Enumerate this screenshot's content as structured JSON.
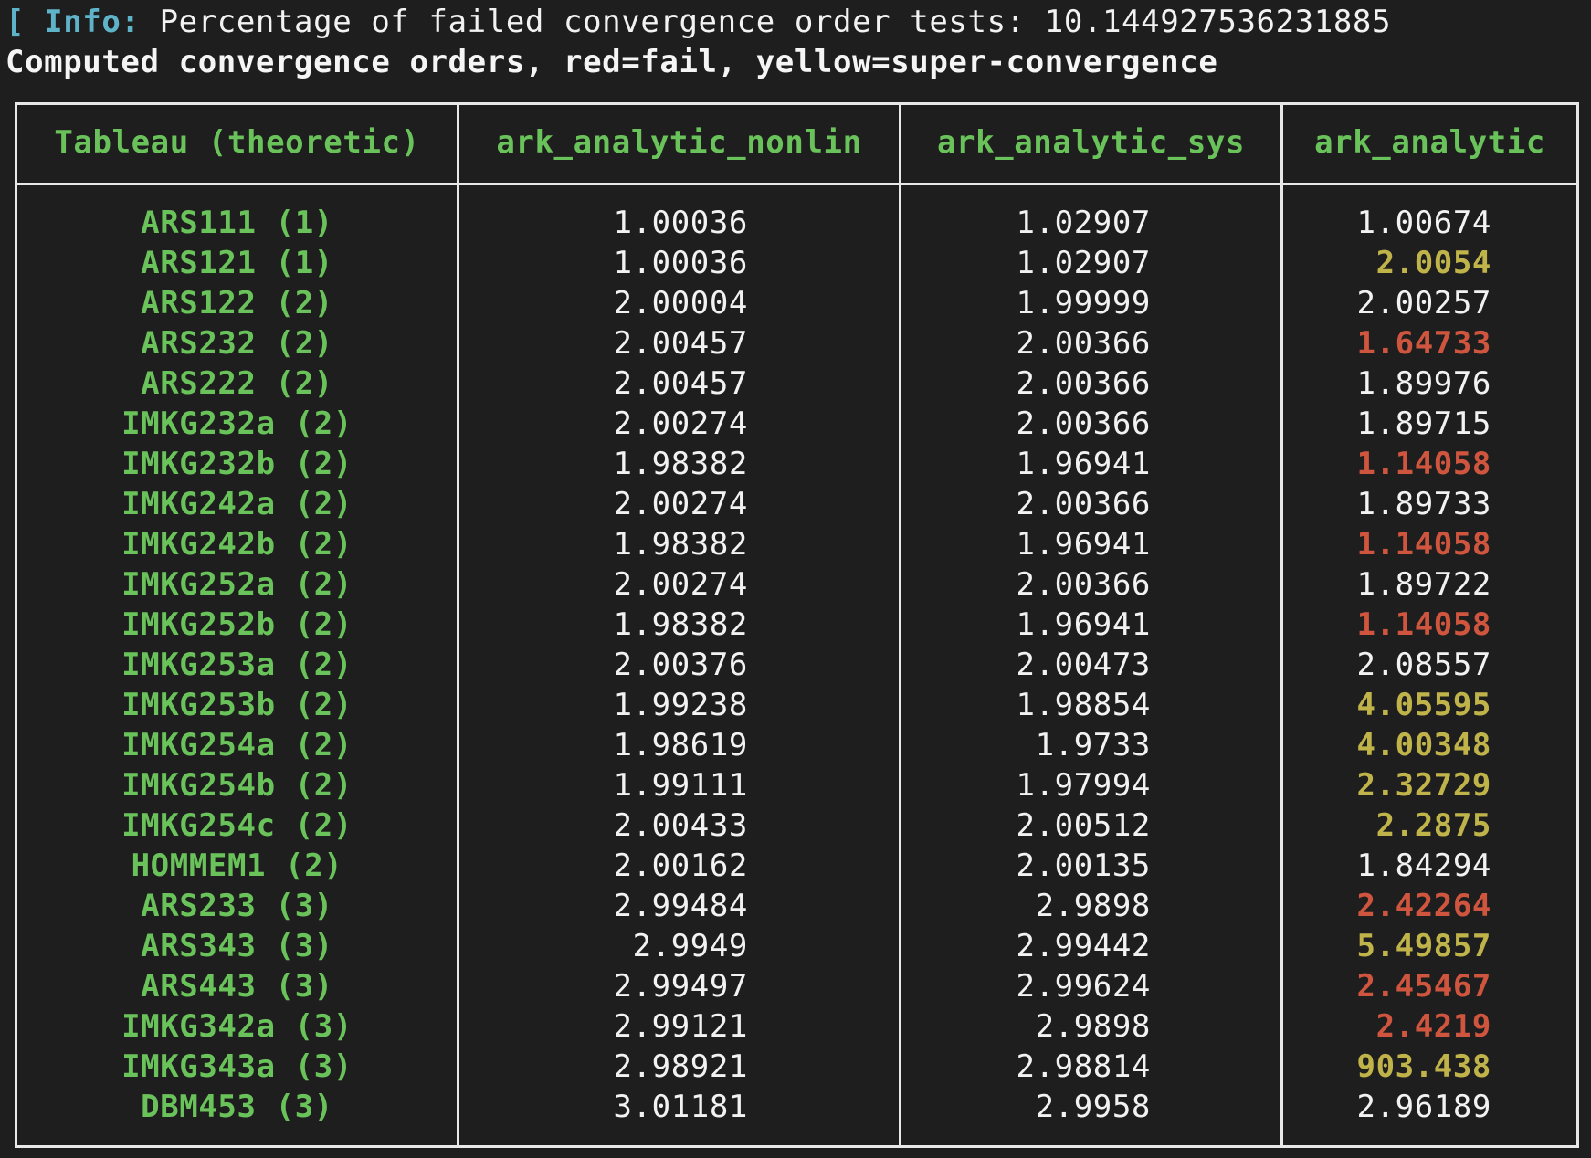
{
  "info": {
    "tag": "[ Info:",
    "text": " Percentage of failed convergence order tests: 10.144927536231885"
  },
  "heading": "Computed convergence orders, red=fail, yellow=super-convergence",
  "colors": {
    "background": "#1e1e1e",
    "text": "#f2f2f2",
    "info": "#5fb3c8",
    "header_green": "#6ac35a",
    "fail_red": "#d0553e",
    "super_yellow": "#bfb34a",
    "border": "#e8e8e8"
  },
  "table": {
    "headers": [
      "Tableau (theoretic)",
      "ark_analytic_nonlin",
      "ark_analytic_sys",
      "ark_analytic"
    ],
    "rows": [
      {
        "name": "ARS111 (1)",
        "v": [
          "1.00036",
          "1.02907",
          "1.00674"
        ],
        "s": [
          "n",
          "n",
          "n"
        ]
      },
      {
        "name": "ARS121 (1)",
        "v": [
          "1.00036",
          "1.02907",
          "2.0054"
        ],
        "s": [
          "n",
          "n",
          "super"
        ]
      },
      {
        "name": "ARS122 (2)",
        "v": [
          "2.00004",
          "1.99999",
          "2.00257"
        ],
        "s": [
          "n",
          "n",
          "n"
        ]
      },
      {
        "name": "ARS232 (2)",
        "v": [
          "2.00457",
          "2.00366",
          "1.64733"
        ],
        "s": [
          "n",
          "n",
          "fail"
        ]
      },
      {
        "name": "ARS222 (2)",
        "v": [
          "2.00457",
          "2.00366",
          "1.89976"
        ],
        "s": [
          "n",
          "n",
          "n"
        ]
      },
      {
        "name": "IMKG232a (2)",
        "v": [
          "2.00274",
          "2.00366",
          "1.89715"
        ],
        "s": [
          "n",
          "n",
          "n"
        ]
      },
      {
        "name": "IMKG232b (2)",
        "v": [
          "1.98382",
          "1.96941",
          "1.14058"
        ],
        "s": [
          "n",
          "n",
          "fail"
        ]
      },
      {
        "name": "IMKG242a (2)",
        "v": [
          "2.00274",
          "2.00366",
          "1.89733"
        ],
        "s": [
          "n",
          "n",
          "n"
        ]
      },
      {
        "name": "IMKG242b (2)",
        "v": [
          "1.98382",
          "1.96941",
          "1.14058"
        ],
        "s": [
          "n",
          "n",
          "fail"
        ]
      },
      {
        "name": "IMKG252a (2)",
        "v": [
          "2.00274",
          "2.00366",
          "1.89722"
        ],
        "s": [
          "n",
          "n",
          "n"
        ]
      },
      {
        "name": "IMKG252b (2)",
        "v": [
          "1.98382",
          "1.96941",
          "1.14058"
        ],
        "s": [
          "n",
          "n",
          "fail"
        ]
      },
      {
        "name": "IMKG253a (2)",
        "v": [
          "2.00376",
          "2.00473",
          "2.08557"
        ],
        "s": [
          "n",
          "n",
          "n"
        ]
      },
      {
        "name": "IMKG253b (2)",
        "v": [
          "1.99238",
          "1.98854",
          "4.05595"
        ],
        "s": [
          "n",
          "n",
          "super"
        ]
      },
      {
        "name": "IMKG254a (2)",
        "v": [
          "1.98619",
          "1.9733",
          "4.00348"
        ],
        "s": [
          "n",
          "n",
          "super"
        ]
      },
      {
        "name": "IMKG254b (2)",
        "v": [
          "1.99111",
          "1.97994",
          "2.32729"
        ],
        "s": [
          "n",
          "n",
          "super"
        ]
      },
      {
        "name": "IMKG254c (2)",
        "v": [
          "2.00433",
          "2.00512",
          "2.2875"
        ],
        "s": [
          "n",
          "n",
          "super"
        ]
      },
      {
        "name": "HOMMEM1 (2)",
        "v": [
          "2.00162",
          "2.00135",
          "1.84294"
        ],
        "s": [
          "n",
          "n",
          "n"
        ]
      },
      {
        "name": "ARS233 (3)",
        "v": [
          "2.99484",
          "2.9898",
          "2.42264"
        ],
        "s": [
          "n",
          "n",
          "fail"
        ]
      },
      {
        "name": "ARS343 (3)",
        "v": [
          "2.9949",
          "2.99442",
          "5.49857"
        ],
        "s": [
          "n",
          "n",
          "super"
        ]
      },
      {
        "name": "ARS443 (3)",
        "v": [
          "2.99497",
          "2.99624",
          "2.45467"
        ],
        "s": [
          "n",
          "n",
          "fail"
        ]
      },
      {
        "name": "IMKG342a (3)",
        "v": [
          "2.99121",
          "2.9898",
          "2.4219"
        ],
        "s": [
          "n",
          "n",
          "fail"
        ]
      },
      {
        "name": "IMKG343a (3)",
        "v": [
          "2.98921",
          "2.98814",
          "903.438"
        ],
        "s": [
          "n",
          "n",
          "super"
        ]
      },
      {
        "name": "DBM453 (3)",
        "v": [
          "3.01181",
          "2.9958",
          "2.96189"
        ],
        "s": [
          "n",
          "n",
          "n"
        ]
      }
    ]
  }
}
